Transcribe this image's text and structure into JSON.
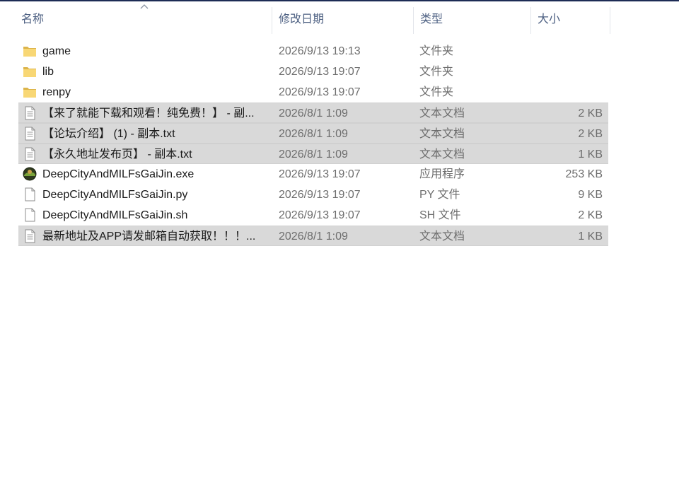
{
  "columns": {
    "name": "名称",
    "date": "修改日期",
    "type": "类型",
    "size": "大小"
  },
  "colors": {
    "header_text": "#4d6082",
    "selected_bg": "#d9d9d9",
    "folder": "#f8d775"
  },
  "files": [
    {
      "icon": "folder-icon",
      "name": "game",
      "date": "2026/9/13 19:13",
      "type": "文件夹",
      "size": "",
      "selected": false
    },
    {
      "icon": "folder-icon",
      "name": "lib",
      "date": "2026/9/13 19:07",
      "type": "文件夹",
      "size": "",
      "selected": false
    },
    {
      "icon": "folder-icon",
      "name": "renpy",
      "date": "2026/9/13 19:07",
      "type": "文件夹",
      "size": "",
      "selected": false
    },
    {
      "icon": "text-file-icon",
      "name": "【来了就能下载和观看！纯免费！】 - 副...",
      "date": "2026/8/1 1:09",
      "type": "文本文档",
      "size": "2 KB",
      "selected": true
    },
    {
      "icon": "text-file-icon",
      "name": "【论坛介绍】 (1) - 副本.txt",
      "date": "2026/8/1 1:09",
      "type": "文本文档",
      "size": "2 KB",
      "selected": true
    },
    {
      "icon": "text-file-icon",
      "name": "【永久地址发布页】 - 副本.txt",
      "date": "2026/8/1 1:09",
      "type": "文本文档",
      "size": "1 KB",
      "selected": true
    },
    {
      "icon": "exe-icon",
      "name": "DeepCityAndMILFsGaiJin.exe",
      "date": "2026/9/13 19:07",
      "type": "应用程序",
      "size": "253 KB",
      "selected": false
    },
    {
      "icon": "blank-file-icon",
      "name": "DeepCityAndMILFsGaiJin.py",
      "date": "2026/9/13 19:07",
      "type": "PY 文件",
      "size": "9 KB",
      "selected": false
    },
    {
      "icon": "blank-file-icon",
      "name": "DeepCityAndMILFsGaiJin.sh",
      "date": "2026/9/13 19:07",
      "type": "SH 文件",
      "size": "2 KB",
      "selected": false
    },
    {
      "icon": "text-file-icon",
      "name": "最新地址及APP请发邮箱自动获取！！！...",
      "date": "2026/8/1 1:09",
      "type": "文本文档",
      "size": "1 KB",
      "selected": true
    }
  ]
}
